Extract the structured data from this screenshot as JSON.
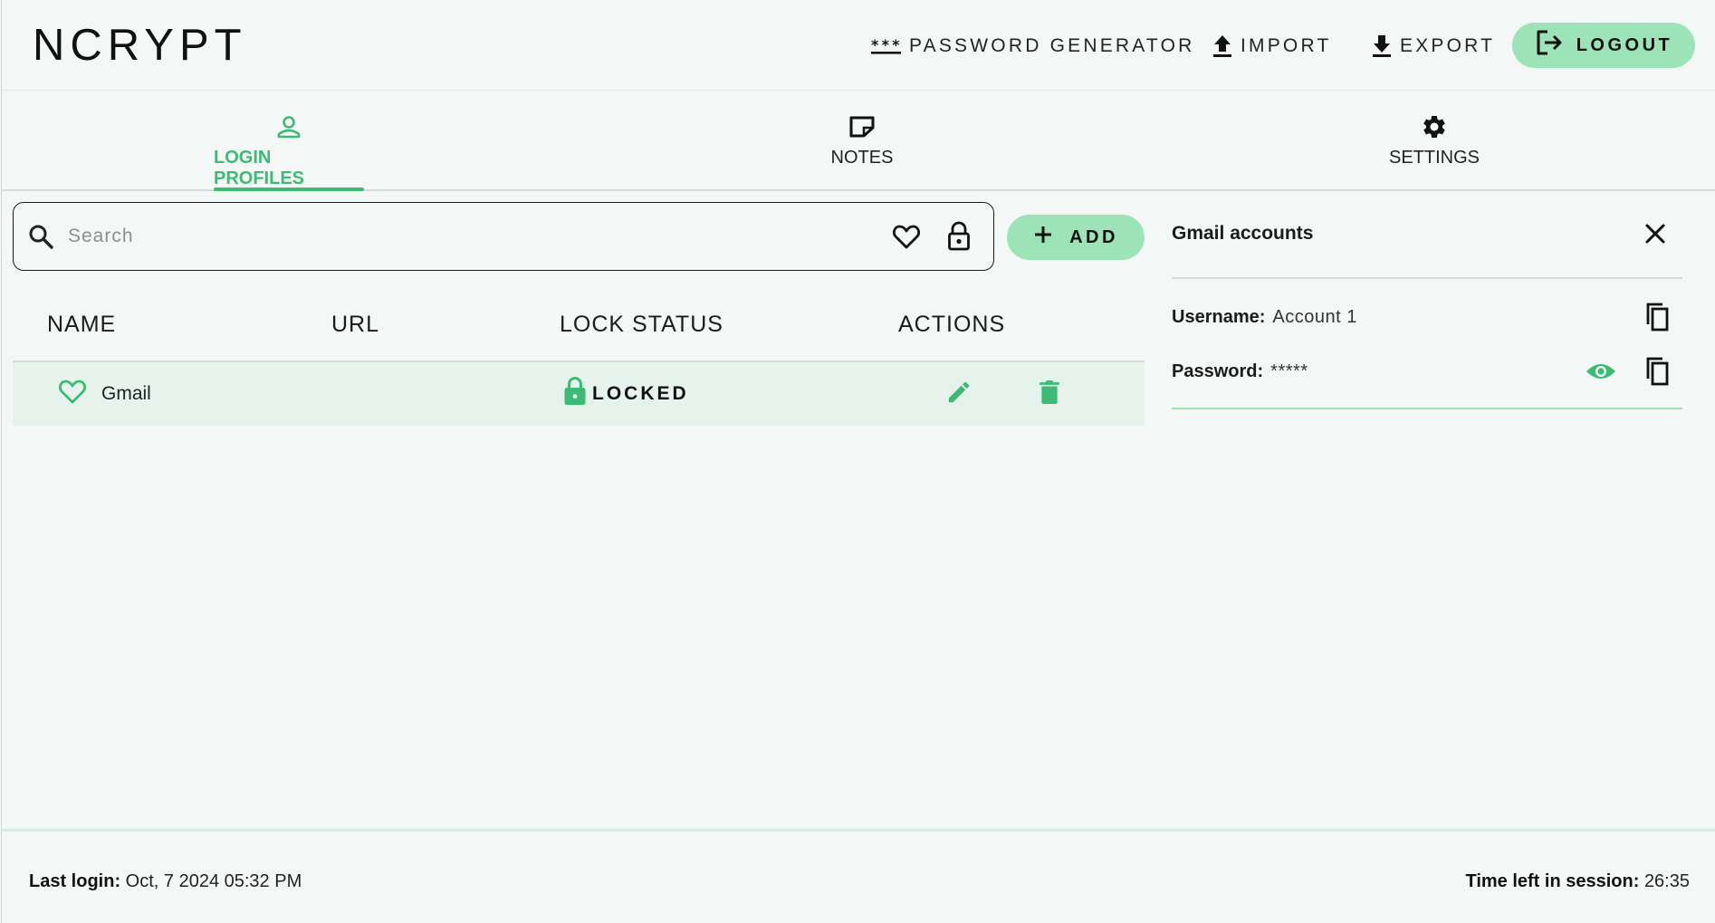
{
  "app": {
    "brand": "NCRYPT"
  },
  "header": {
    "password_generator": "PASSWORD GENERATOR",
    "import": "IMPORT",
    "export": "EXPORT",
    "logout": "LOGOUT"
  },
  "tabs": [
    {
      "label": "LOGIN PROFILES",
      "icon": "person-icon",
      "active": true
    },
    {
      "label": "NOTES",
      "icon": "note-icon",
      "active": false
    },
    {
      "label": "SETTINGS",
      "icon": "gear-icon",
      "active": false
    }
  ],
  "search": {
    "placeholder": "Search",
    "value": ""
  },
  "add_button": "ADD",
  "table": {
    "columns": [
      "NAME",
      "URL",
      "LOCK STATUS",
      "ACTIONS"
    ],
    "rows": [
      {
        "name": "Gmail",
        "url": "",
        "lock_status": "LOCKED",
        "favorite": true
      }
    ]
  },
  "details": {
    "title": "Gmail accounts",
    "username_label": "Username:",
    "username_value": "Account 1",
    "password_label": "Password:",
    "password_value": "*****"
  },
  "footer": {
    "last_login_label": "Last login:",
    "last_login_value": "Oct, 7 2024 05:32 PM",
    "session_label": "Time left in session:",
    "session_value": "26:35"
  },
  "colors": {
    "accent": "#3dbb74",
    "button_bg": "#9de3b8",
    "background": "#f3f8f6",
    "row_highlight": "#e6f3ec"
  }
}
